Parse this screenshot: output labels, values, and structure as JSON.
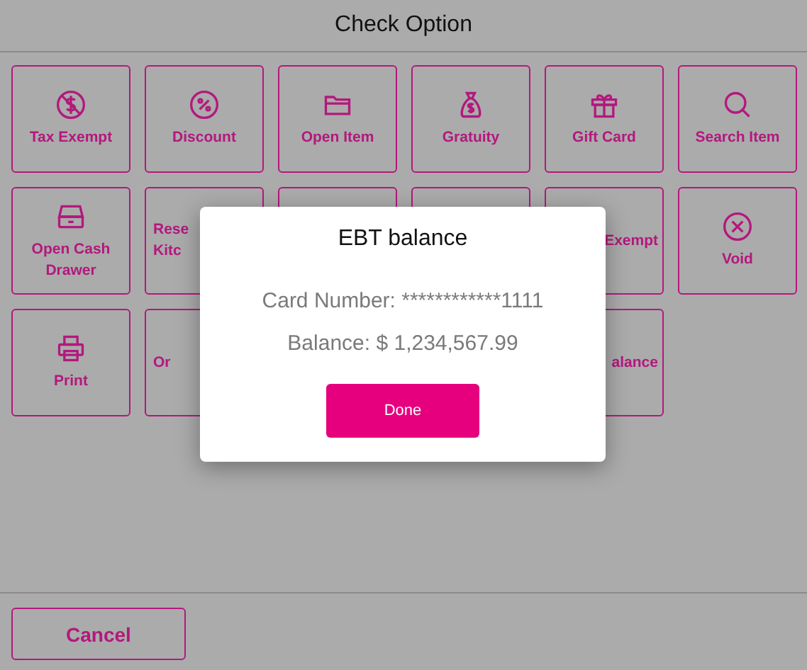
{
  "header": {
    "title": "Check Option"
  },
  "tiles": [
    {
      "label": "Tax Exempt",
      "kind": "full"
    },
    {
      "label": "Discount",
      "kind": "full"
    },
    {
      "label": "Open Item",
      "kind": "full"
    },
    {
      "label": "Gratuity",
      "kind": "full"
    },
    {
      "label": "Gift Card",
      "kind": "full"
    },
    {
      "label": "Search Item",
      "kind": "full"
    },
    {
      "label": "Open Cash Drawer",
      "kind": "full"
    },
    {
      "label": "Rese\nKitc",
      "kind": "leftpart"
    },
    {
      "kind": "hidden"
    },
    {
      "kind": "hidden"
    },
    {
      "label": "Exempt",
      "kind": "rightpart"
    },
    {
      "label": "Void",
      "kind": "full"
    },
    {
      "label": "Print",
      "kind": "full"
    },
    {
      "label": "Or",
      "kind": "leftpart"
    },
    {
      "kind": "covered"
    },
    {
      "kind": "covered"
    },
    {
      "label": "alance",
      "kind": "rightpart"
    }
  ],
  "footer": {
    "cancel": "Cancel"
  },
  "dialog": {
    "title": "EBT balance",
    "card_number": "Card Number: ************1111",
    "balance": "Balance: $ 1,234,567.99",
    "done": "Done"
  }
}
